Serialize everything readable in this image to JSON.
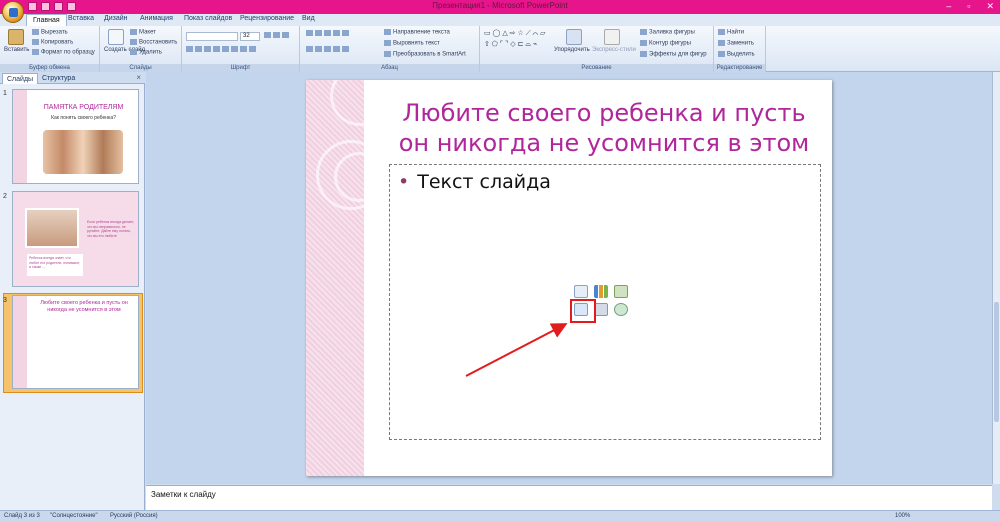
{
  "window": {
    "title": "Презентация1 - Microsoft PowerPoint"
  },
  "tabs": [
    "Главная",
    "Вставка",
    "Дизайн",
    "Анимация",
    "Показ слайдов",
    "Рецензирование",
    "Вид"
  ],
  "ribbon": {
    "clipboard": {
      "paste": "Вставить",
      "cut": "Вырезать",
      "copy": "Копировать",
      "format_painter": "Формат по образцу",
      "label": "Буфер обмена"
    },
    "slides": {
      "new_slide": "Создать слайд",
      "layout": "Макет",
      "reset": "Восстановить",
      "delete": "Удалить",
      "label": "Слайды"
    },
    "font": {
      "label": "Шрифт",
      "size": "32"
    },
    "paragraph": {
      "label": "Абзац",
      "text_direction": "Направление текста",
      "align_text": "Выровнять текст",
      "smartart": "Преобразовать в SmartArt"
    },
    "drawing": {
      "arrange": "Упорядочить",
      "quick_styles": "Экспресс-стили",
      "fill": "Заливка фигуры",
      "outline": "Контур фигуры",
      "effects": "Эффекты для фигур",
      "label": "Рисование"
    },
    "editing": {
      "find": "Найти",
      "replace": "Заменить",
      "select": "Выделить",
      "label": "Редактирование"
    }
  },
  "panel": {
    "tab_slides": "Слайды",
    "tab_outline": "Структура",
    "close": "×",
    "thumbnails": [
      {
        "num": "1",
        "title": "ПАМЯТКА РОДИТЕЛЯМ",
        "subtitle": "Как понять своего ребенка?"
      },
      {
        "num": "2",
        "body": "Если ребенок иногда делает, что вы неправильно, не ругайте. Дайте ему понять, что вы его любите",
        "caption": "Ребенок всегда знает, что любят его родители, понимают, а также ..."
      },
      {
        "num": "3",
        "title": "Любите своего ребенка и пусть он никогда не усомнится в этом"
      }
    ]
  },
  "slide": {
    "title": "Любите своего ребенка и пусть он никогда не усомнится в этом",
    "bullet": "Текст слайда"
  },
  "notes": {
    "text": "Заметки к слайду"
  },
  "status": {
    "slide": "Слайд 3 из 3",
    "theme": "\"Солнцестояние\"",
    "language": "Русский (Россия)",
    "zoom": "100%"
  }
}
